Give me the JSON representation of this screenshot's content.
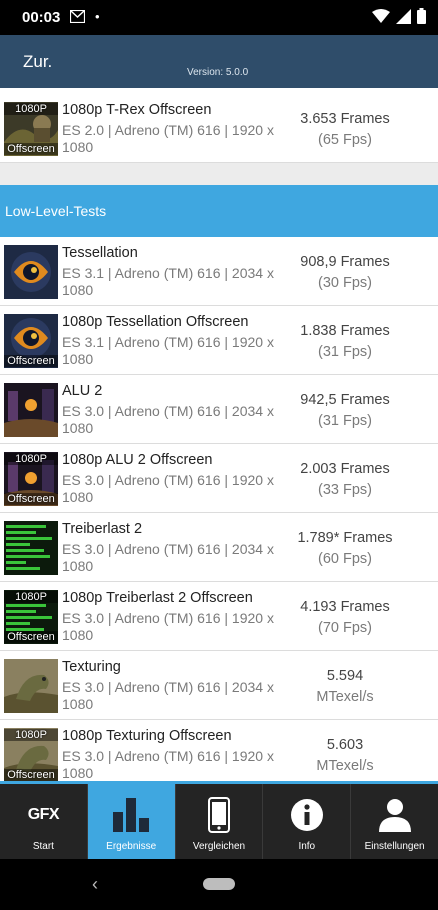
{
  "status_bar": {
    "time": "00:03",
    "dot": "•"
  },
  "app_bar": {
    "title": "Zur.",
    "version": "Version: 5.0.0"
  },
  "top_results": [
    {
      "name": "1080p T-Rex Offscreen",
      "sub": "ES 2.0 | Adreno (TM) 616 | 1920 x 1080",
      "score": "3.653 Frames",
      "fps": "(65 Fps)",
      "thumb_top": "1080P",
      "thumb_bottom": "Offscreen",
      "icon": "trex-thumbnail-icon"
    }
  ],
  "section": {
    "title": "Low-Level-Tests"
  },
  "results": [
    {
      "name": "Tessellation",
      "sub": "ES 3.1 | Adreno (TM) 616 | 2034 x 1080",
      "score": "908,9 Frames",
      "fps": "(30 Fps)",
      "thumb_top": "",
      "thumb_bottom": "",
      "icon": "tessellation-thumbnail-icon"
    },
    {
      "name": "1080p Tessellation Offscreen",
      "sub": "ES 3.1 | Adreno (TM) 616 | 1920 x 1080",
      "score": "1.838 Frames",
      "fps": "(31 Fps)",
      "thumb_top": "",
      "thumb_bottom": "Offscreen",
      "icon": "tessellation-offscreen-thumbnail-icon"
    },
    {
      "name": "ALU 2",
      "sub": "ES 3.0 | Adreno (TM) 616 | 2034 x 1080",
      "score": "942,5 Frames",
      "fps": "(31 Fps)",
      "thumb_top": "",
      "thumb_bottom": "",
      "icon": "alu-thumbnail-icon"
    },
    {
      "name": "1080p ALU 2 Offscreen",
      "sub": "ES 3.0 | Adreno (TM) 616 | 1920 x 1080",
      "score": "2.003 Frames",
      "fps": "(33 Fps)",
      "thumb_top": "1080P",
      "thumb_bottom": "Offscreen",
      "icon": "alu-offscreen-thumbnail-icon"
    },
    {
      "name": "Treiberlast 2",
      "sub": "ES 3.0 | Adreno (TM) 616 | 2034 x 1080",
      "score": "1.789* Frames",
      "fps": "(60 Fps)",
      "thumb_top": "",
      "thumb_bottom": "",
      "icon": "driver-overhead-thumbnail-icon"
    },
    {
      "name": "1080p Treiberlast 2 Offscreen",
      "sub": "ES 3.0 | Adreno (TM) 616 | 1920 x 1080",
      "score": "4.193 Frames",
      "fps": "(70 Fps)",
      "thumb_top": "1080P",
      "thumb_bottom": "Offscreen",
      "icon": "driver-overhead-offscreen-thumbnail-icon"
    },
    {
      "name": "Texturing",
      "sub": "ES 3.0 | Adreno (TM) 616 | 2034 x 1080",
      "score": "5.594",
      "fps": "MTexel/s",
      "thumb_top": "",
      "thumb_bottom": "",
      "icon": "texturing-thumbnail-icon"
    },
    {
      "name": "1080p Texturing Offscreen",
      "sub": "ES 3.0 | Adreno (TM) 616 | 1920 x 1080",
      "score": "5.603",
      "fps": "MTexel/s",
      "thumb_top": "1080P",
      "thumb_bottom": "Offscreen",
      "icon": "texturing-offscreen-thumbnail-icon"
    }
  ],
  "nav": {
    "start": {
      "logo": "GFX",
      "label": "Start"
    },
    "results": {
      "label": "Ergebnisse"
    },
    "compare": {
      "label": "Vergleichen"
    },
    "info": {
      "label": "Info"
    },
    "settings": {
      "label": "Einstellungen"
    }
  },
  "colors": {
    "app_bar": "#2f4d6a",
    "accent": "#3fa7e0",
    "nav_bg": "#242424"
  }
}
